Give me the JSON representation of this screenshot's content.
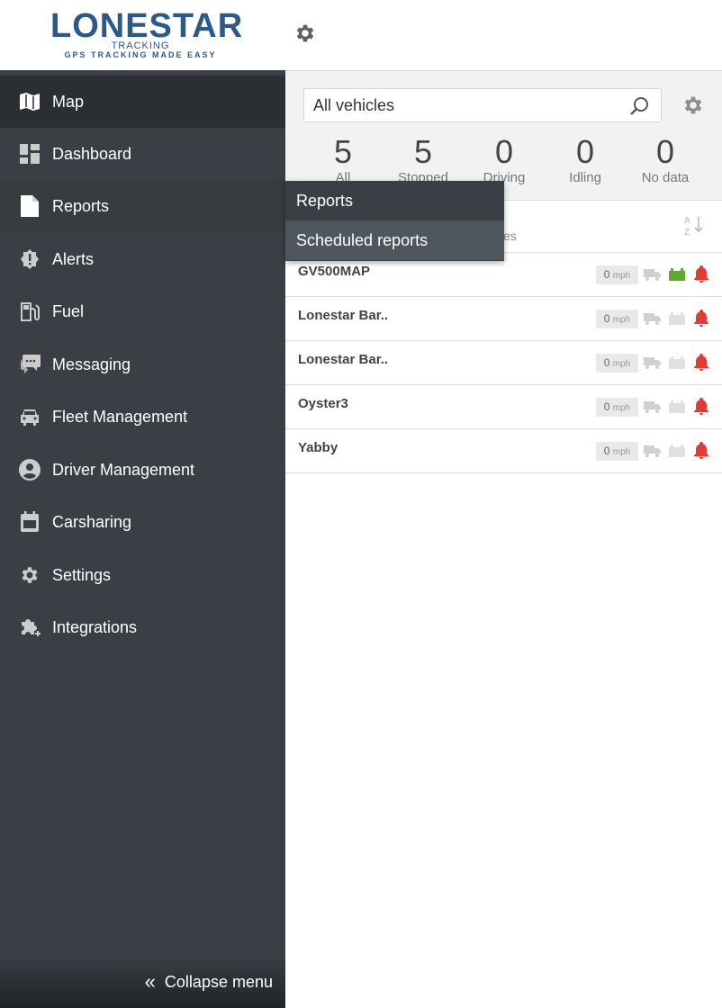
{
  "logo": {
    "main": "LONESTAR",
    "sub": "TRACKING",
    "tagline": "GPS TRACKING MADE EASY"
  },
  "sidebar": {
    "items": [
      {
        "label": "Map",
        "icon": "map-icon"
      },
      {
        "label": "Dashboard",
        "icon": "dashboard-icon"
      },
      {
        "label": "Reports",
        "icon": "document-icon"
      },
      {
        "label": "Alerts",
        "icon": "alert-icon"
      },
      {
        "label": "Fuel",
        "icon": "fuel-icon"
      },
      {
        "label": "Messaging",
        "icon": "chat-icon"
      },
      {
        "label": "Fleet Management",
        "icon": "car-icon"
      },
      {
        "label": "Driver Management",
        "icon": "user-icon"
      },
      {
        "label": "Carsharing",
        "icon": "carsharing-icon"
      },
      {
        "label": "Settings",
        "icon": "gear-icon"
      },
      {
        "label": "Integrations",
        "icon": "puzzle-icon"
      }
    ],
    "collapse_label": "Collapse menu"
  },
  "submenu": {
    "items": [
      "Reports",
      "Scheduled reports"
    ]
  },
  "search": {
    "value": "All vehicles"
  },
  "stats": [
    {
      "count": "5",
      "label": "All"
    },
    {
      "count": "5",
      "label": "Stopped"
    },
    {
      "count": "0",
      "label": "Driving"
    },
    {
      "count": "0",
      "label": "Idling"
    },
    {
      "count": "0",
      "label": "No data"
    }
  ],
  "sort_row": {
    "partial_label": "es"
  },
  "speed_unit": "mph",
  "vehicles": [
    {
      "name": "GV500MAP",
      "speed": "0",
      "battery_ok": true
    },
    {
      "name": "Lonestar Bar..",
      "speed": "0",
      "battery_ok": false
    },
    {
      "name": "Lonestar Bar..",
      "speed": "0",
      "battery_ok": false
    },
    {
      "name": "Oyster3",
      "speed": "0",
      "battery_ok": false
    },
    {
      "name": "Yabby",
      "speed": "0",
      "battery_ok": false
    }
  ],
  "colors": {
    "sidebar": "#3a3f45",
    "active": "#2b2f33",
    "alert_red": "#e53935",
    "battery_green": "#5aab2c",
    "brand_blue": "#2b5a8a"
  }
}
